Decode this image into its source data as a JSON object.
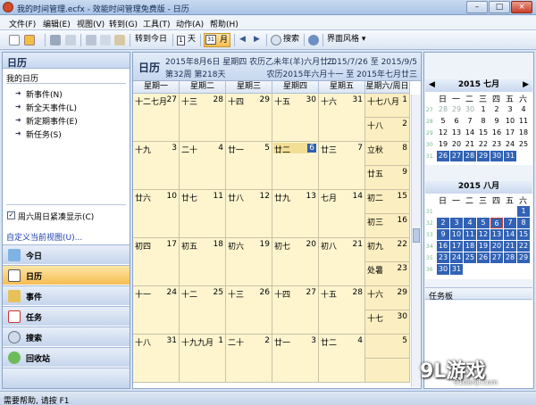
{
  "window": {
    "title": "我的时间管理.ecfx - 效能时间管理免费版 - 日历",
    "min": "–",
    "max": "□",
    "close": "×"
  },
  "menu": [
    {
      "label": "文件(F)"
    },
    {
      "label": "编辑(E)"
    },
    {
      "label": "视图(V)"
    },
    {
      "label": "转到(G)"
    },
    {
      "label": "工具(T)"
    },
    {
      "label": "动作(A)"
    },
    {
      "label": "帮助(H)"
    }
  ],
  "toolbar": {
    "goto_today": "转到今日",
    "day": "天",
    "month": "月",
    "day_num": "1",
    "month_num": "31",
    "search": "搜索",
    "theme": "界面风格 ▾"
  },
  "left": {
    "header": "日历",
    "my_calendar": "我的日历",
    "actions": [
      "新事件(N)",
      "新全天事件(L)",
      "新定期事件(E)",
      "新任务(S)"
    ],
    "weekend_compact": "周六周日紧凑显示(C)",
    "custom_view": "自定义当前视图(U)...",
    "nav": [
      {
        "label": "今日",
        "icon": "today-icon"
      },
      {
        "label": "日历",
        "icon": "calendar-icon"
      },
      {
        "label": "事件",
        "icon": "event-icon"
      },
      {
        "label": "任务",
        "icon": "task-icon"
      },
      {
        "label": "搜索",
        "icon": "search-icon"
      },
      {
        "label": "回收站",
        "icon": "recycle-bin-icon"
      }
    ]
  },
  "center": {
    "title": "日历",
    "date_line": "2015年8月6日 星期四 农历乙未年(羊)六月廿二",
    "week_line": "第32周 第218天",
    "range_line": "2015/7/26 至 2015/9/5",
    "lunar_range_line": "农历2015年六月十一 至 2015年七月廿三",
    "day_headers": [
      "星期一",
      "星期二",
      "星期三",
      "星期四",
      "星期五",
      "星期六/周日"
    ],
    "weeks": [
      {
        "days": [
          {
            "lunar": "十二",
            "lunar2": "七月",
            "day": "27"
          },
          {
            "lunar": "十三",
            "day": "28"
          },
          {
            "lunar": "十四",
            "day": "29"
          },
          {
            "lunar": "十五",
            "day": "30"
          },
          {
            "lunar": "十六",
            "day": "31"
          }
        ],
        "sat": {
          "lunar": "十七",
          "lunar2": "八月",
          "day": "1"
        },
        "sun": {
          "lunar": "十八",
          "day": "2"
        }
      },
      {
        "days": [
          {
            "lunar": "十九",
            "day": "3"
          },
          {
            "lunar": "二十",
            "day": "4"
          },
          {
            "lunar": "廿一",
            "day": "5"
          },
          {
            "lunar": "廿二",
            "day": "6"
          },
          {
            "lunar": "廿三",
            "day": "7"
          }
        ],
        "sat": {
          "lunar": "立秋",
          "day": "8"
        },
        "sun": {
          "lunar": "廿五",
          "day": "9"
        }
      },
      {
        "days": [
          {
            "lunar": "廿六",
            "day": "10"
          },
          {
            "lunar": "廿七",
            "day": "11"
          },
          {
            "lunar": "廿八",
            "day": "12"
          },
          {
            "lunar": "廿九",
            "day": "13"
          },
          {
            "lunar": "七月",
            "day": "14"
          }
        ],
        "sat": {
          "lunar": "初二",
          "day": "15"
        },
        "sun": {
          "lunar": "初三",
          "day": "16"
        }
      },
      {
        "days": [
          {
            "lunar": "初四",
            "day": "17"
          },
          {
            "lunar": "初五",
            "day": "18"
          },
          {
            "lunar": "初六",
            "day": "19"
          },
          {
            "lunar": "初七",
            "day": "20"
          },
          {
            "lunar": "初八",
            "day": "21"
          }
        ],
        "sat": {
          "lunar": "初九",
          "day": "22"
        },
        "sun": {
          "lunar": "处暑",
          "day": "23"
        }
      },
      {
        "days": [
          {
            "lunar": "十一",
            "day": "24"
          },
          {
            "lunar": "十二",
            "day": "25"
          },
          {
            "lunar": "十三",
            "day": "26"
          },
          {
            "lunar": "十四",
            "day": "27"
          },
          {
            "lunar": "十五",
            "day": "28"
          }
        ],
        "sat": {
          "lunar": "十六",
          "day": "29"
        },
        "sun": {
          "lunar": "十七",
          "day": "30"
        }
      },
      {
        "days": [
          {
            "lunar": "十八",
            "day": "31"
          },
          {
            "lunar": "十九",
            "lunar2": "九月",
            "day": "1"
          },
          {
            "lunar": "二十",
            "day": "2"
          },
          {
            "lunar": "廿一",
            "day": "3"
          },
          {
            "lunar": "廿二",
            "day": "4"
          }
        ],
        "sat": {
          "lunar": "",
          "day": "5"
        },
        "sun": {
          "lunar": "",
          "day": ""
        }
      }
    ]
  },
  "right": {
    "cal1": {
      "title": "2015 七月",
      "weekdays": [
        "日",
        "一",
        "二",
        "三",
        "四",
        "五",
        "六"
      ],
      "rows": [
        {
          "wk": "27",
          "d": [
            "28",
            "29",
            "30",
            "1",
            "2",
            "3",
            "4"
          ]
        },
        {
          "wk": "28",
          "d": [
            "5",
            "6",
            "7",
            "8",
            "9",
            "10",
            "11"
          ]
        },
        {
          "wk": "29",
          "d": [
            "12",
            "13",
            "14",
            "15",
            "16",
            "17",
            "18"
          ]
        },
        {
          "wk": "30",
          "d": [
            "19",
            "20",
            "21",
            "22",
            "23",
            "24",
            "25"
          ]
        },
        {
          "wk": "31",
          "d": [
            "26",
            "27",
            "28",
            "29",
            "30",
            "31",
            ""
          ]
        }
      ]
    },
    "cal2": {
      "title": "2015 八月",
      "weekdays": [
        "日",
        "一",
        "二",
        "三",
        "四",
        "五",
        "六"
      ],
      "rows": [
        {
          "wk": "31",
          "d": [
            "",
            "",
            "",
            "",
            "",
            "",
            "1"
          ]
        },
        {
          "wk": "32",
          "d": [
            "2",
            "3",
            "4",
            "5",
            "6",
            "7",
            "8"
          ]
        },
        {
          "wk": "33",
          "d": [
            "9",
            "10",
            "11",
            "12",
            "13",
            "14",
            "15"
          ]
        },
        {
          "wk": "34",
          "d": [
            "16",
            "17",
            "18",
            "19",
            "20",
            "21",
            "22"
          ]
        },
        {
          "wk": "35",
          "d": [
            "23",
            "24",
            "25",
            "26",
            "27",
            "28",
            "29"
          ]
        },
        {
          "wk": "36",
          "d": [
            "30",
            "31",
            "",
            "",
            "",
            "",
            ""
          ]
        }
      ]
    },
    "prev": "◀",
    "next": "▶",
    "tasks": "任务板"
  },
  "status": "需要帮助, 请按 F1",
  "watermark": {
    "brand": "9L游戏",
    "url": "91danji.com"
  },
  "colors": {
    "accent": "#3162b5",
    "cell_bg": "#fef5cf",
    "nav_active": "#f6bd52"
  }
}
